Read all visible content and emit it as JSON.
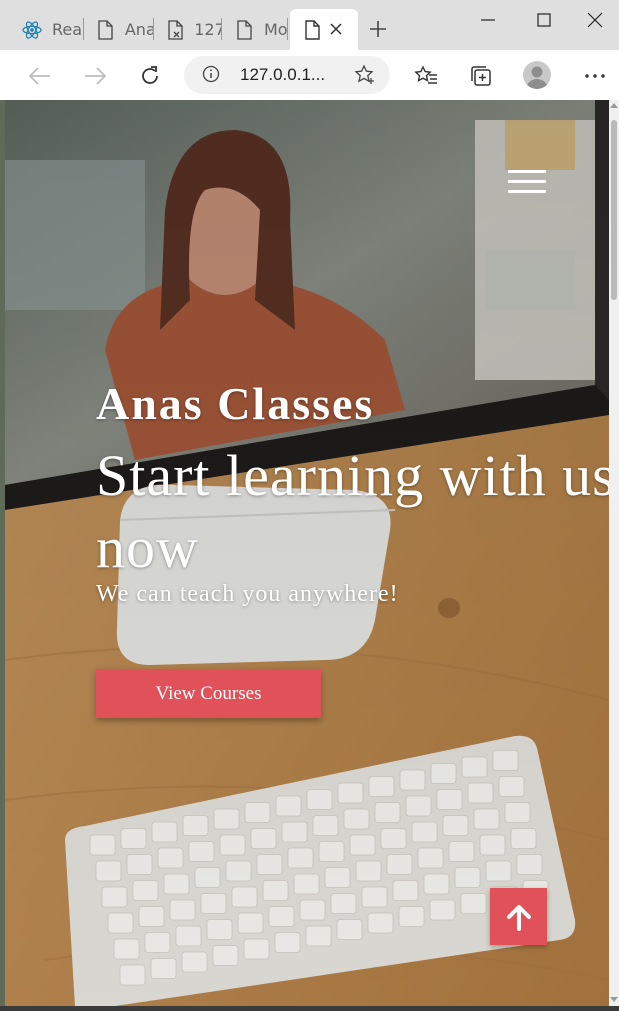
{
  "browser": {
    "tabs": [
      {
        "label": "Rea",
        "icon": "react-icon",
        "active": false
      },
      {
        "label": "Ana",
        "icon": "page-icon",
        "active": false
      },
      {
        "label": "127",
        "icon": "page-error-icon",
        "active": false
      },
      {
        "label": "Mo",
        "icon": "page-icon",
        "active": false
      },
      {
        "label": "",
        "icon": "page-icon",
        "active": true
      }
    ],
    "address_url": "127.0.0.1...",
    "window_controls": [
      "minimize-icon",
      "maximize-icon",
      "close-icon"
    ],
    "toolbar_icons": [
      "back-icon",
      "forward-icon",
      "refresh-icon",
      "favorites-icon",
      "collections-icon",
      "profile-icon",
      "more-icon"
    ]
  },
  "page": {
    "brand": "Anas Classes",
    "headline": "Start learning with us now",
    "subheadline": "We can teach you anywhere!",
    "cta_label": "View Courses",
    "menu_icon": "hamburger-menu-icon",
    "scroll_top_icon": "arrow-up-icon"
  },
  "colors": {
    "accent": "#e0515a",
    "tabstrip": "#dfdfdf",
    "toolbar": "#ffffff",
    "hero_text": "#ffffff"
  }
}
